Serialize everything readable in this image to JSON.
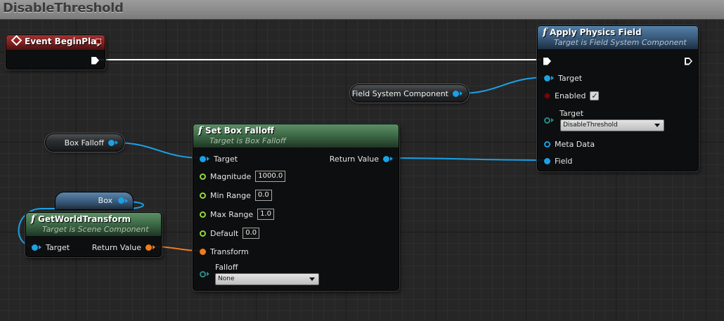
{
  "graph": {
    "title": "DisableThreshold"
  },
  "colors": {
    "vector_wire": "#1aa1e6",
    "transform_wire": "#f07b1c",
    "exec_wire": "#ffffff",
    "bool_pin": "#6c0b0b",
    "float_pin": "#93d63c"
  },
  "event_node": {
    "title": "Event BeginPlay",
    "icon": "event-diamond-icon"
  },
  "apply_physics_field": {
    "title": "Apply Physics Field",
    "subtitle": "Target is Field System Component",
    "pins": {
      "target": "Target",
      "enabled": "Enabled",
      "enabled_checked": true,
      "target2": "Target",
      "target2_value": "DisableThreshold",
      "meta_data": "Meta Data",
      "field": "Field"
    }
  },
  "field_system_component": {
    "label": "Field System Component"
  },
  "box_falloff_var": {
    "label": "Box Falloff"
  },
  "box_var": {
    "label": "Box"
  },
  "set_box_falloff": {
    "title": "Set Box Falloff",
    "subtitle": "Target is Box Falloff",
    "pins": {
      "target": "Target",
      "return_value": "Return Value",
      "magnitude": "Magnitude",
      "magnitude_value": "1000.0",
      "min_range": "Min Range",
      "min_range_value": "0.0",
      "max_range": "Max Range",
      "max_range_value": "1.0",
      "default": "Default",
      "default_value": "0.0",
      "transform": "Transform",
      "falloff": "Falloff",
      "falloff_value": "None"
    }
  },
  "get_world_transform": {
    "title": "GetWorldTransform",
    "subtitle": "Target is Scene Component",
    "pins": {
      "target": "Target",
      "return_value": "Return Value"
    }
  }
}
